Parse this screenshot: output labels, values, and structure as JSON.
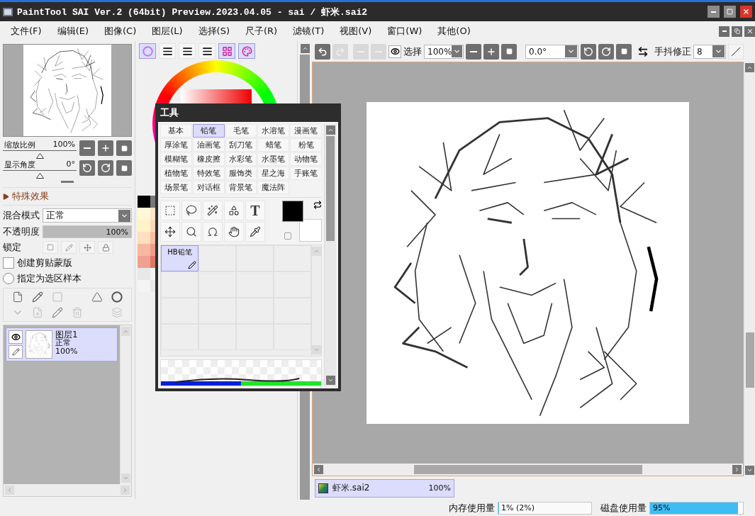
{
  "window": {
    "title": "PaintTool SAI Ver.2 (64bit) Preview.2023.04.05 - sai / 虾米.sai2"
  },
  "menu": [
    "文件(F)",
    "编辑(E)",
    "图像(C)",
    "图层(L)",
    "选择(S)",
    "尺子(R)",
    "滤镜(T)",
    "视图(V)",
    "窗口(W)",
    "其他(O)"
  ],
  "navigator": {
    "zoom": {
      "label": "缩放比例",
      "reading": "100%",
      "level": 0.5
    },
    "angle": {
      "label": "显示角度",
      "reading": "0°",
      "level": 0.5
    }
  },
  "effects": {
    "label": "特殊效果",
    "expanded": false
  },
  "layer_properties": {
    "blend_label": "混合模式",
    "blend_value": "正常",
    "opacity": {
      "label": "不透明度",
      "reading": "100%",
      "level": 1
    },
    "lock_label": "锁定",
    "clipping": {
      "label": "创建剪贴蒙版",
      "checked": false
    },
    "selection_source": {
      "label": "指定为选区样本",
      "selected": false
    }
  },
  "layers": [
    {
      "name": "图层1",
      "mode": "正常",
      "opacity": "100%",
      "visible": true,
      "selected": true
    }
  ],
  "color_tabs": [
    {
      "selected": true
    },
    {
      "selected": false
    },
    {
      "selected": false
    },
    {
      "selected": false
    },
    {
      "selected": true
    },
    {
      "selected": true
    }
  ],
  "tool_panel": {
    "title": "工具",
    "categories": [
      {
        "label": "基本",
        "selected": false
      },
      {
        "label": "铅笔",
        "selected": true
      },
      {
        "label": "毛笔",
        "selected": false
      },
      {
        "label": "水溶笔",
        "selected": false
      },
      {
        "label": "漫画笔",
        "selected": false
      },
      {
        "label": "厚涂笔",
        "selected": false
      },
      {
        "label": "油画笔",
        "selected": false
      },
      {
        "label": "刮刀笔",
        "selected": false
      },
      {
        "label": "蜡笔",
        "selected": false
      },
      {
        "label": "粉笔",
        "selected": false
      },
      {
        "label": "模糊笔",
        "selected": false
      },
      {
        "label": "橡皮擦",
        "selected": false
      },
      {
        "label": "水彩笔",
        "selected": false
      },
      {
        "label": "水墨笔",
        "selected": false
      },
      {
        "label": "动物笔",
        "selected": false
      },
      {
        "label": "植物笔",
        "selected": false
      },
      {
        "label": "特效笔",
        "selected": false
      },
      {
        "label": "服饰类",
        "selected": false
      },
      {
        "label": "星之海",
        "selected": false
      },
      {
        "label": "手账笔",
        "selected": false
      },
      {
        "label": "场景笔",
        "selected": false
      },
      {
        "label": "对话框",
        "selected": false
      },
      {
        "label": "背景笔",
        "selected": false
      },
      {
        "label": "魔法阵",
        "selected": false
      }
    ],
    "text_tool": "T",
    "brushes": [
      {
        "label": "HB铅笔",
        "selected": true
      }
    ]
  },
  "canvas_toolbar": {
    "select_label": "选择",
    "zoom": "100%",
    "angle": "0.0°",
    "stabilizer_label": "手抖修正",
    "stabilizer": "8"
  },
  "documents": [
    {
      "name": "虾米.sai2",
      "zoom": "100%",
      "selected": true
    }
  ],
  "status": {
    "memory": {
      "label": "内存使用量",
      "reading": "1% (2%)",
      "level": 0.01
    },
    "disk": {
      "label": "磁盘使用量",
      "reading": "95%",
      "level": 0.95
    }
  }
}
